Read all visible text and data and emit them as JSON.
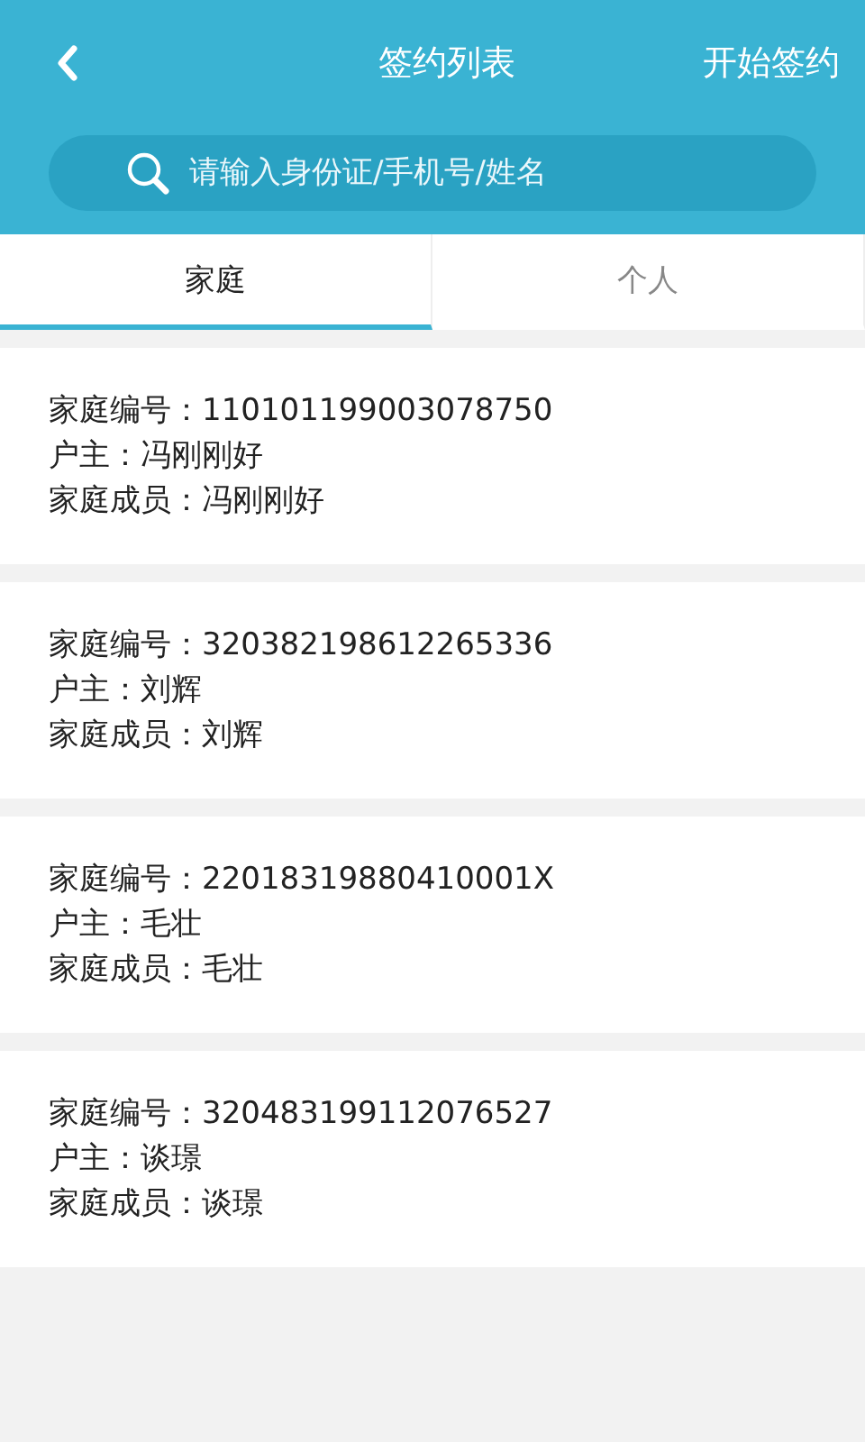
{
  "header": {
    "title": "签约列表",
    "action": "开始签约"
  },
  "search": {
    "placeholder": "请输入身份证/手机号/姓名"
  },
  "tabs": [
    {
      "label": "家庭",
      "selected": true
    },
    {
      "label": "个人",
      "selected": false
    }
  ],
  "families": [
    {
      "lines": [
        {
          "label": "家庭编号：",
          "value": "110101199003078750"
        },
        {
          "label": "户主：",
          "value": "冯刚刚好"
        },
        {
          "label": "家庭成员：",
          "value": "冯刚刚好"
        }
      ]
    },
    {
      "lines": [
        {
          "label": "家庭编号：",
          "value": "320382198612265336"
        },
        {
          "label": "户主：",
          "value": "刘辉"
        },
        {
          "label": "家庭成员：",
          "value": "刘辉"
        }
      ]
    },
    {
      "lines": [
        {
          "label": "家庭编号：",
          "value": "22018319880410001X"
        },
        {
          "label": "户主：",
          "value": "毛壮"
        },
        {
          "label": "家庭成员：",
          "value": "毛壮"
        }
      ]
    },
    {
      "lines": [
        {
          "label": "家庭编号：",
          "value": "320483199112076527"
        },
        {
          "label": "户主：",
          "value": "谈璟"
        },
        {
          "label": "家庭成员：",
          "value": "谈璟"
        }
      ]
    }
  ]
}
